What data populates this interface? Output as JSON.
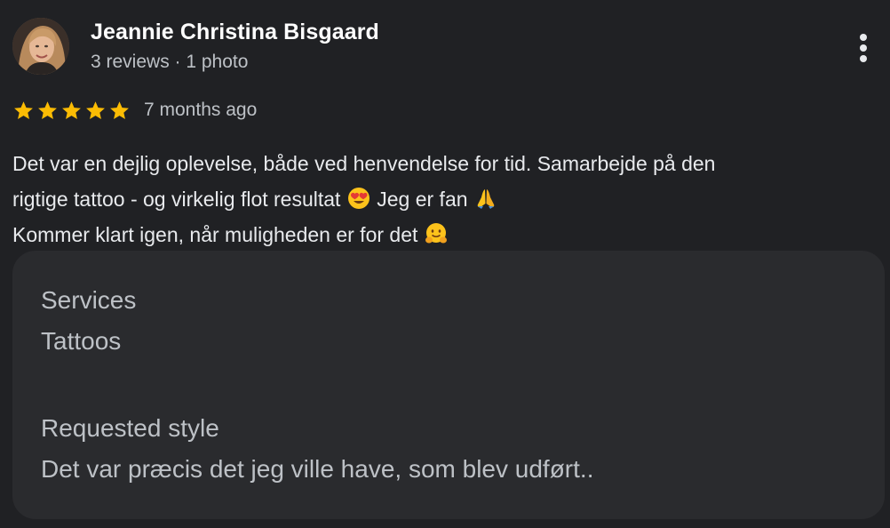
{
  "review": {
    "author": {
      "name": "Jeannie Christina Bisgaard",
      "meta": "3 reviews · 1 photo",
      "avatar_icon": "profile-photo"
    },
    "rating": {
      "stars": 5,
      "max_stars": 5,
      "star_color": "#fbbc04"
    },
    "date": "7 months ago",
    "text": {
      "line1": "Det var en dejlig oplevelse, både ved henvendelse for tid. Samarbejde på den",
      "line2_part1": "rigtige tattoo - og virkelig flot resultat ",
      "line2_emoji1": "smiling-face-with-heart-eyes",
      "line2_part2": " Jeg er fan ",
      "line2_emoji2": "folded-hands",
      "line3_part1": "Kommer klart igen, når muligheden er for det ",
      "line3_emoji": "hugging-face"
    },
    "details": {
      "services_label": "Services",
      "services_value": "Tattoos",
      "style_label": "Requested style",
      "style_value": "Det var præcis det jeg ville have, som blev udført.."
    },
    "menu_icon": "more-vertical-icon"
  },
  "colors": {
    "background": "#202124",
    "card": "#2a2b2e",
    "primary_text": "#e8eaed",
    "secondary_text": "#bdc1c6",
    "star": "#fbbc04"
  }
}
